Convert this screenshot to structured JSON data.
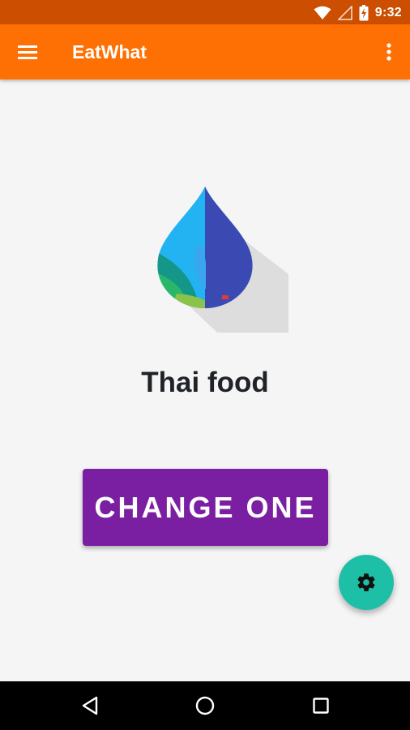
{
  "status_bar": {
    "time": "9:32",
    "icons": [
      "wifi-icon",
      "signal-icon",
      "battery-charging-icon"
    ]
  },
  "app_bar": {
    "title": "EatWhat",
    "icons": [
      "menu-icon",
      "more-vert-icon"
    ]
  },
  "main": {
    "logo": "water-drop-logo",
    "food_name": "Thai food",
    "change_button_label": "CHANGE ONE"
  },
  "fab": {
    "icon": "gear-icon"
  },
  "nav_bar": {
    "icons": [
      "back-icon",
      "home-icon",
      "recents-icon"
    ]
  },
  "colors": {
    "status_bar": "#cc4e00",
    "app_bar": "#ff7004",
    "background": "#f5f5f5",
    "button": "#7b1fa2",
    "fab": "#1dbfa6",
    "nav_bar": "#000000"
  }
}
